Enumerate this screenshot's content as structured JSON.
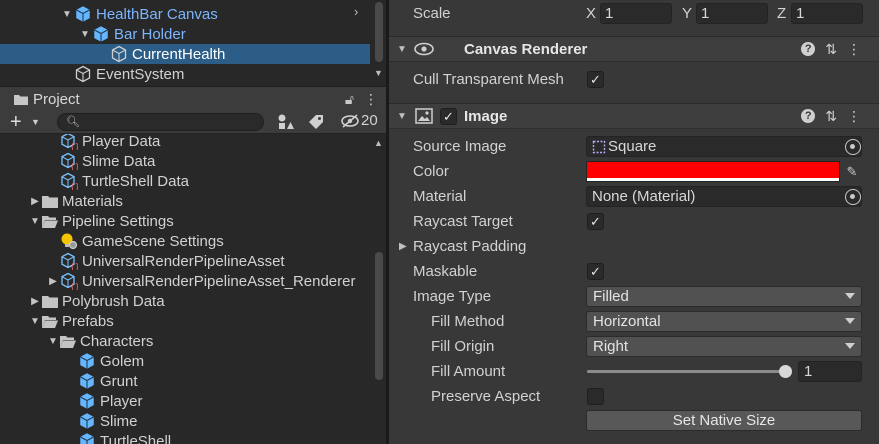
{
  "hierarchy": {
    "items": [
      {
        "label": "HealthBar Canvas",
        "depth": 1,
        "expanded": true,
        "style": "blue"
      },
      {
        "label": "Bar Holder",
        "depth": 2,
        "expanded": true,
        "style": "blue"
      },
      {
        "label": "CurrentHealth",
        "depth": 3,
        "expanded": false,
        "style": "white",
        "selected": true
      },
      {
        "label": "EventSystem",
        "depth": 1,
        "expanded": false,
        "style": "normal"
      }
    ]
  },
  "project": {
    "tab_label": "Project",
    "visible_count": "20",
    "search_placeholder": "",
    "items": [
      {
        "label": "Player Data",
        "depth": 2,
        "kind": "data"
      },
      {
        "label": "Slime Data",
        "depth": 2,
        "kind": "data"
      },
      {
        "label": "TurtleShell Data",
        "depth": 2,
        "kind": "data"
      },
      {
        "label": "Materials",
        "depth": 1,
        "kind": "folder",
        "arrow": "collapsed"
      },
      {
        "label": "Pipeline Settings",
        "depth": 1,
        "kind": "folder-open",
        "arrow": "expanded"
      },
      {
        "label": "GameScene Settings",
        "depth": 2,
        "kind": "settings"
      },
      {
        "label": "UniversalRenderPipelineAsset",
        "depth": 2,
        "kind": "data"
      },
      {
        "label": "UniversalRenderPipelineAsset_Renderer",
        "depth": 2,
        "kind": "data",
        "arrow": "collapsed"
      },
      {
        "label": "Polybrush Data",
        "depth": 1,
        "kind": "folder",
        "arrow": "collapsed"
      },
      {
        "label": "Prefabs",
        "depth": 1,
        "kind": "folder-open",
        "arrow": "expanded"
      },
      {
        "label": "Characters",
        "depth": 2,
        "kind": "folder-open",
        "arrow": "expanded"
      },
      {
        "label": "Golem",
        "depth": 3,
        "kind": "prefab"
      },
      {
        "label": "Grunt",
        "depth": 3,
        "kind": "prefab"
      },
      {
        "label": "Player",
        "depth": 3,
        "kind": "prefab"
      },
      {
        "label": "Slime",
        "depth": 3,
        "kind": "prefab"
      },
      {
        "label": "TurtleShell",
        "depth": 3,
        "kind": "prefab"
      }
    ]
  },
  "inspector": {
    "scale": {
      "label": "Scale",
      "x_label": "X",
      "x": "1",
      "y_label": "Y",
      "y": "1",
      "z_label": "Z",
      "z": "1"
    },
    "canvas_renderer": {
      "title": "Canvas Renderer",
      "cull_label": "Cull Transparent Mesh",
      "cull_checked": "✓"
    },
    "image": {
      "title": "Image",
      "enabled_check": "✓",
      "source_image_label": "Source Image",
      "source_image_value": "Square",
      "color_label": "Color",
      "color_value": "#ff0000",
      "material_label": "Material",
      "material_value": "None (Material)",
      "raycast_target_label": "Raycast Target",
      "raycast_target_checked": "✓",
      "raycast_padding_label": "Raycast Padding",
      "maskable_label": "Maskable",
      "maskable_checked": "✓",
      "image_type_label": "Image Type",
      "image_type_value": "Filled",
      "fill_method_label": "Fill Method",
      "fill_method_value": "Horizontal",
      "fill_origin_label": "Fill Origin",
      "fill_origin_value": "Right",
      "fill_amount_label": "Fill Amount",
      "fill_amount_value": "1",
      "fill_amount_fraction": 1,
      "preserve_aspect_label": "Preserve Aspect",
      "preserve_aspect_checked": "",
      "set_native_size_label": "Set Native Size"
    }
  },
  "colors": {
    "selection": "#2c5d87",
    "hierarchy_blue": "#7cb6ff",
    "prefab_cube": "#66b6ff"
  }
}
